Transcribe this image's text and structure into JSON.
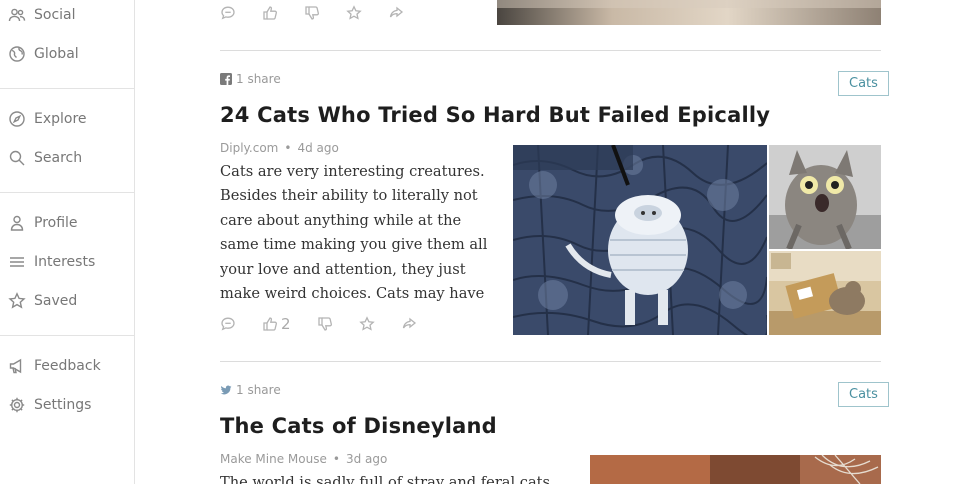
{
  "sidebar": {
    "items": [
      {
        "name": "social",
        "label": "Social",
        "icon": "users-icon"
      },
      {
        "name": "global",
        "label": "Global",
        "icon": "globe-icon"
      },
      {
        "name": "explore",
        "label": "Explore",
        "icon": "compass-icon"
      },
      {
        "name": "search",
        "label": "Search",
        "icon": "search-icon"
      },
      {
        "name": "profile",
        "label": "Profile",
        "icon": "user-icon"
      },
      {
        "name": "interests",
        "label": "Interests",
        "icon": "list-icon"
      },
      {
        "name": "saved",
        "label": "Saved",
        "icon": "star-icon"
      },
      {
        "name": "feedback",
        "label": "Feedback",
        "icon": "megaphone-icon"
      },
      {
        "name": "settings",
        "label": "Settings",
        "icon": "gear-icon"
      }
    ]
  },
  "feed": {
    "articles": [
      {
        "share_text": "1 share",
        "share_icon": "facebook-icon",
        "tag": "Cats",
        "title": "24 Cats Who Tried So Hard But Failed Epically",
        "source": "Diply.com",
        "dot": "•",
        "age": "4d ago",
        "excerpt": "Cats are very interesting creatures. Besides their ability to literally not care about anything while at the same time making you give them all your love and attention, they just make weird choices. Cats may have nine lives and",
        "likes": "2"
      },
      {
        "share_text": "1 share",
        "share_icon": "twitter-icon",
        "tag": "Cats",
        "title": "The Cats of Disneyland",
        "source": "Make Mine Mouse",
        "dot": "•",
        "age": "3d ago",
        "excerpt": "The world is sadly full of stray and feral cats, and a"
      }
    ]
  },
  "colors": {
    "tag_border": "#9fc4cc",
    "tag_text": "#4a90a0",
    "facebook": "#7a7a7a",
    "twitter": "#7a9bb5"
  }
}
